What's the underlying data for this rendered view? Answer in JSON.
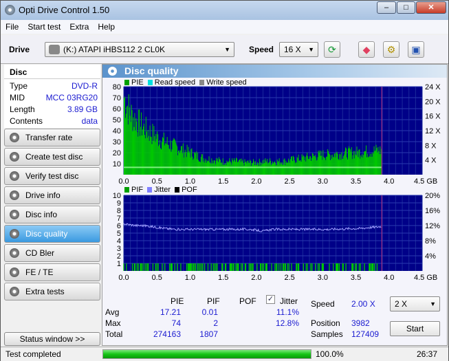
{
  "window": {
    "title": "Opti Drive Control 1.50",
    "minimize": "–",
    "maximize": "□",
    "close": "✕"
  },
  "menu": [
    "File",
    "Start test",
    "Extra",
    "Help"
  ],
  "toolbar": {
    "drive_label": "Drive",
    "drive_value": "(K:)   ATAPI iHBS112   2 CL0K",
    "speed_label": "Speed",
    "speed_value": "16 X"
  },
  "disc": {
    "header": "Disc",
    "rows": [
      {
        "k": "Type",
        "v": "DVD-R"
      },
      {
        "k": "MID",
        "v": "MCC 03RG20"
      },
      {
        "k": "Length",
        "v": "3.89 GB"
      },
      {
        "k": "Contents",
        "v": "data"
      }
    ]
  },
  "nav": [
    "Transfer rate",
    "Create test disc",
    "Verify test disc",
    "Drive info",
    "Disc info",
    "Disc quality",
    "CD Bler",
    "FE / TE",
    "Extra tests"
  ],
  "nav_active": "Disc quality",
  "status_window": "Status window >>",
  "panel_title": "Disc quality",
  "chart_data": [
    {
      "type": "area",
      "legend": [
        {
          "name": "PIE",
          "color": "#00c000"
        },
        {
          "name": "Read speed",
          "color": "#00e0e0"
        },
        {
          "name": "Write speed",
          "color": "#888888"
        }
      ],
      "x_ticks": [
        "0.0",
        "0.5",
        "1.0",
        "1.5",
        "2.0",
        "2.5",
        "3.0",
        "3.5",
        "4.0",
        "4.5 GB"
      ],
      "xlim": [
        0,
        4.5
      ],
      "y_ticks": [
        "10",
        "20",
        "30",
        "40",
        "50",
        "60",
        "70",
        "80"
      ],
      "ylim": [
        0,
        80
      ],
      "y2_ticks": [
        "4 X",
        "8 X",
        "12 X",
        "16 X",
        "20 X",
        "24 X"
      ],
      "y2lim": [
        0,
        24
      ],
      "x_step": 0.1,
      "pie": [
        70,
        55,
        48,
        42,
        38,
        34,
        30,
        27,
        25,
        22,
        20,
        17,
        15,
        14,
        13,
        12,
        12,
        12,
        11,
        11,
        11,
        12,
        12,
        12,
        12,
        13,
        14,
        15,
        16,
        17,
        18,
        18,
        19,
        19,
        20,
        20,
        21,
        21,
        22
      ],
      "read_speed_x": 2.0,
      "end_gb": 3.89
    },
    {
      "type": "line",
      "legend": [
        {
          "name": "PIF",
          "color": "#00c000"
        },
        {
          "name": "Jitter",
          "color": "#8080ff"
        },
        {
          "name": "POF",
          "color": "#000000"
        }
      ],
      "x_ticks": [
        "0.0",
        "0.5",
        "1.0",
        "1.5",
        "2.0",
        "2.5",
        "3.0",
        "3.5",
        "4.0",
        "4.5 GB"
      ],
      "xlim": [
        0,
        4.5
      ],
      "y_ticks": [
        "1",
        "2",
        "3",
        "4",
        "5",
        "6",
        "7",
        "8",
        "9",
        "10"
      ],
      "ylim": [
        0,
        10
      ],
      "y2_ticks": [
        "4%",
        "8%",
        "12%",
        "16%",
        "20%"
      ],
      "y2lim": [
        0,
        20
      ],
      "x_step": 0.1,
      "jitter": [
        12.5,
        12.2,
        12,
        12,
        11.8,
        11.5,
        11.3,
        11.1,
        11,
        11,
        11,
        11,
        11,
        11,
        11,
        11,
        11,
        11,
        11,
        11,
        10.8,
        10.5,
        10.9,
        11,
        11,
        11,
        11,
        11,
        11,
        11,
        11,
        11,
        11.1,
        11.1,
        11.2,
        11.2,
        11.3,
        11.5,
        11.6,
        11.8
      ],
      "pif": [
        1,
        2,
        1,
        1,
        1,
        2,
        1,
        1,
        1,
        1,
        1,
        1,
        1,
        1,
        1,
        1,
        1,
        1,
        1,
        1,
        1,
        1,
        1,
        1,
        1,
        1,
        1,
        1,
        1,
        1,
        1,
        1,
        1,
        1,
        1,
        1,
        1,
        1,
        1
      ]
    }
  ],
  "stats": {
    "headers": [
      "PIE",
      "PIF",
      "POF",
      "Jitter"
    ],
    "jitter_checked": true,
    "rows": [
      {
        "label": "Avg",
        "pie": "17.21",
        "pif": "0.01",
        "pof": "",
        "jitter": "11.1%"
      },
      {
        "label": "Max",
        "pie": "74",
        "pif": "2",
        "pof": "",
        "jitter": "12.8%"
      },
      {
        "label": "Total",
        "pie": "274163",
        "pif": "1807",
        "pof": "",
        "jitter": ""
      }
    ],
    "speed_label": "Speed",
    "speed_value": "2.00 X",
    "position_label": "Position",
    "position_value": "3982",
    "samples_label": "Samples",
    "samples_value": "127409",
    "speed_select": "2 X",
    "start": "Start"
  },
  "status": {
    "text": "Test completed",
    "progress": 100.0,
    "progress_text": "100.0%",
    "time": "26:37"
  }
}
